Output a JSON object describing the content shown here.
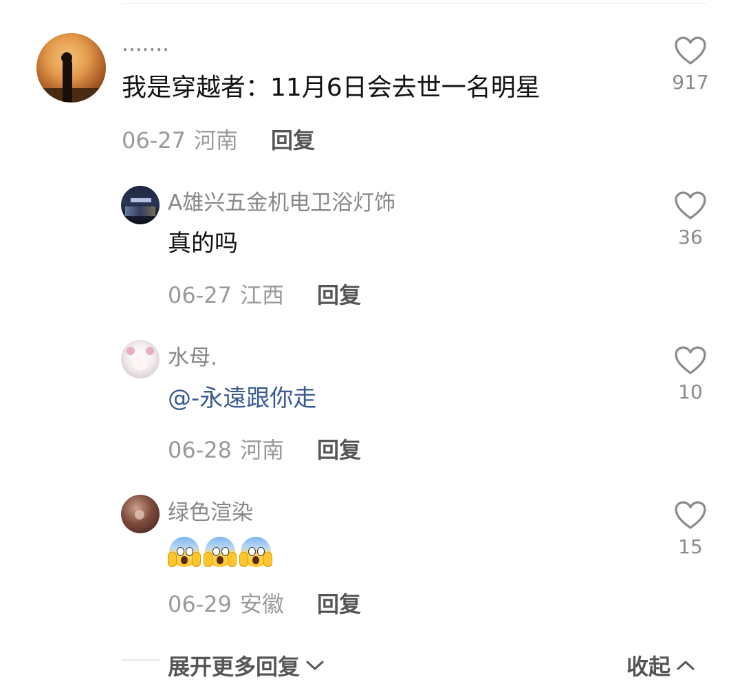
{
  "main_comment": {
    "username": "·······",
    "text": "我是穿越者：11月6日会去世一名明星",
    "date": "06-27",
    "region": "河南",
    "reply_label": "回复",
    "likes": "917"
  },
  "replies": [
    {
      "username": "A雄兴五金机电卫浴灯饰",
      "text": "真的吗",
      "date": "06-27",
      "region": "江西",
      "reply_label": "回复",
      "likes": "36"
    },
    {
      "username": "水母.",
      "text": "@-永遠跟你走",
      "date": "06-28",
      "region": "河南",
      "reply_label": "回复",
      "likes": "10"
    },
    {
      "username": "绿色渲染",
      "text": "😱😱😱",
      "date": "06-29",
      "region": "安徽",
      "reply_label": "回复",
      "likes": "15"
    }
  ],
  "footer": {
    "expand_label": "展开更多回复",
    "collapse_label": "收起"
  },
  "icons": {
    "like": "heart-outline-icon",
    "expand": "chevron-down-icon",
    "collapse": "chevron-up-icon"
  }
}
